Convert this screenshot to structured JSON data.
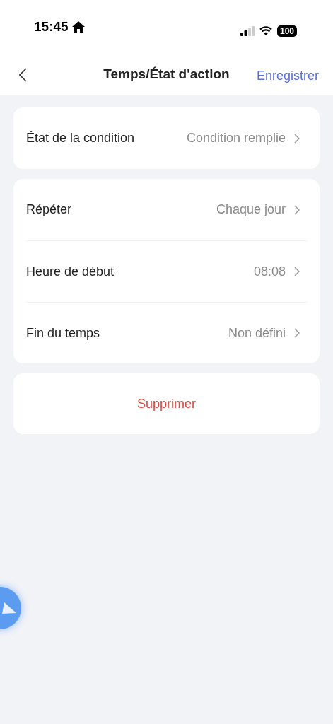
{
  "status_bar": {
    "time": "15:45",
    "battery": "100"
  },
  "header": {
    "title": "Temps/État d'action",
    "action": "Enregistrer"
  },
  "groups": [
    {
      "rows": [
        {
          "label": "État de la condition",
          "value": "Condition remplie"
        }
      ]
    },
    {
      "rows": [
        {
          "label": "Répéter",
          "value": "Chaque jour"
        },
        {
          "label": "Heure de début",
          "value": "08:08"
        },
        {
          "label": "Fin du temps",
          "value": "Non défini"
        }
      ]
    }
  ],
  "delete_button": "Supprimer"
}
